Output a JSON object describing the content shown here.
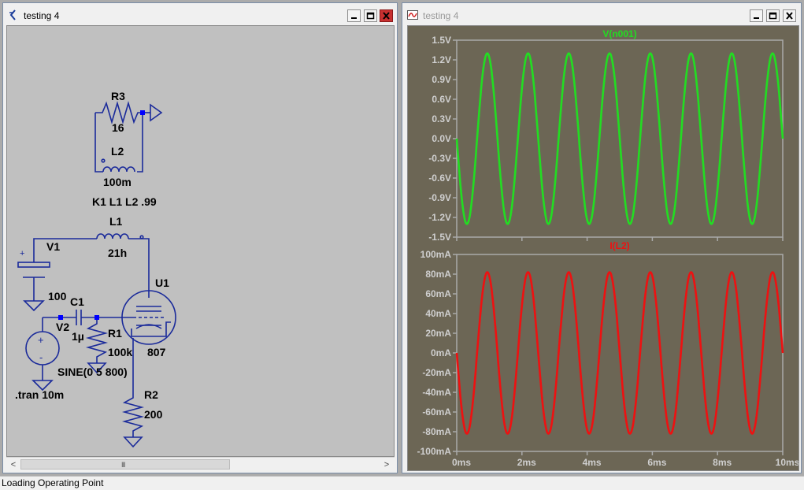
{
  "schematic_window": {
    "title": "testing 4",
    "components": {
      "r3": {
        "name": "R3",
        "value": "16"
      },
      "l2": {
        "name": "L2",
        "value": "100m"
      },
      "k1": {
        "directive": "K1 L1 L2 .99"
      },
      "l1": {
        "name": "L1",
        "value": "21h"
      },
      "v1": {
        "name": "V1",
        "value": "100"
      },
      "c1": {
        "name": "C1",
        "value": "1µ"
      },
      "v2": {
        "name": "V2",
        "value": "SINE(0 5 800)"
      },
      "r1": {
        "name": "R1",
        "value": "100k"
      },
      "u1": {
        "name": "U1",
        "value": "807"
      },
      "r2": {
        "name": "R2",
        "value": "200"
      },
      "tran": {
        "directive": ".tran 10m"
      }
    },
    "scrollbar": {
      "left_arrow": "<",
      "right_arrow": ">",
      "grip": "III"
    }
  },
  "plot_window": {
    "title": "testing 4",
    "colors": {
      "background": "#6c6655",
      "grid": "#aaaaaa",
      "voltage_trace": "#22dd22",
      "current_trace": "#ee1111"
    },
    "x_ticks": [
      "0ms",
      "2ms",
      "4ms",
      "6ms",
      "8ms",
      "10ms"
    ]
  },
  "chart_data": [
    {
      "type": "line",
      "title": "V(n001)",
      "x": [
        0,
        10
      ],
      "xlim": [
        0,
        10
      ],
      "ylim": [
        -1.5,
        1.5
      ],
      "y_ticks": [
        "1.5V",
        "1.2V",
        "0.9V",
        "0.6V",
        "0.3V",
        "0.0V",
        "-0.3V",
        "-0.6V",
        "-0.9V",
        "-1.2V",
        "-1.5V"
      ],
      "series": [
        {
          "name": "V(n001)",
          "waveform": "sine",
          "amplitude": 1.3,
          "frequency_hz": 800,
          "phase": "inverted",
          "x_start_ms": 0,
          "x_end_ms": 10,
          "color": "#22dd22"
        }
      ],
      "grid": true
    },
    {
      "type": "line",
      "title": "I(L2)",
      "xlim": [
        0,
        10
      ],
      "ylim": [
        -100,
        100
      ],
      "y_ticks": [
        "100mA",
        "80mA",
        "60mA",
        "40mA",
        "20mA",
        "0mA",
        "-20mA",
        "-40mA",
        "-60mA",
        "-80mA",
        "-100mA"
      ],
      "series": [
        {
          "name": "I(L2)",
          "waveform": "sine",
          "amplitude": 82,
          "frequency_hz": 800,
          "phase": "inverted",
          "x_start_ms": 0,
          "x_end_ms": 10,
          "color": "#ee1111"
        }
      ],
      "grid": true
    }
  ],
  "status_bar": {
    "text": "Loading Operating Point"
  }
}
